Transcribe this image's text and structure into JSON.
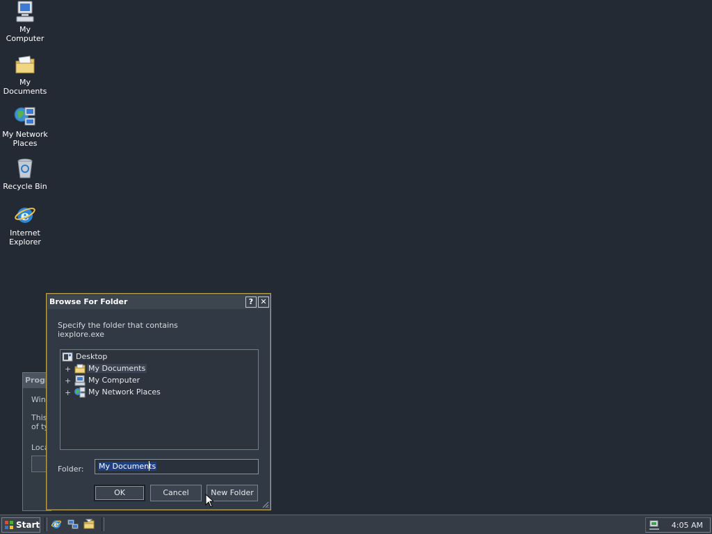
{
  "desktop": {
    "icons": [
      {
        "label": "My Computer"
      },
      {
        "label": "My Documents"
      },
      {
        "label_line1": "My Network",
        "label_line2": "Places"
      },
      {
        "label": "Recycle Bin"
      },
      {
        "label_line1": "Internet",
        "label_line2": "Explorer"
      }
    ]
  },
  "background_dialog": {
    "title": "Progr",
    "line1": "Winc",
    "line2": "This",
    "line3": "of ty",
    "line4": "Loca"
  },
  "dialog": {
    "title": "Browse For Folder",
    "help_button": "?",
    "close_button": "✕",
    "prompt_line1": "Specify the folder that contains",
    "prompt_line2": "iexplore.exe",
    "tree": {
      "root": "Desktop",
      "children": [
        {
          "label": "My Documents",
          "expander": "+",
          "selected": true
        },
        {
          "label": "My Computer",
          "expander": "+"
        },
        {
          "label": "My Network Places",
          "expander": "+"
        }
      ]
    },
    "folder_label": "Folder:",
    "folder_value": "My Documents",
    "buttons": {
      "ok": "OK",
      "cancel": "Cancel",
      "new_folder": "New Folder"
    }
  },
  "taskbar": {
    "start_label": "Start",
    "quick_launch": [
      "internet-explorer-icon",
      "network-icon",
      "my-documents-icon"
    ],
    "clock": "4:05 AM",
    "colors": {
      "desktop": "#242a33",
      "title_accent": "#b79d43",
      "selection": "#1f3f83"
    }
  }
}
